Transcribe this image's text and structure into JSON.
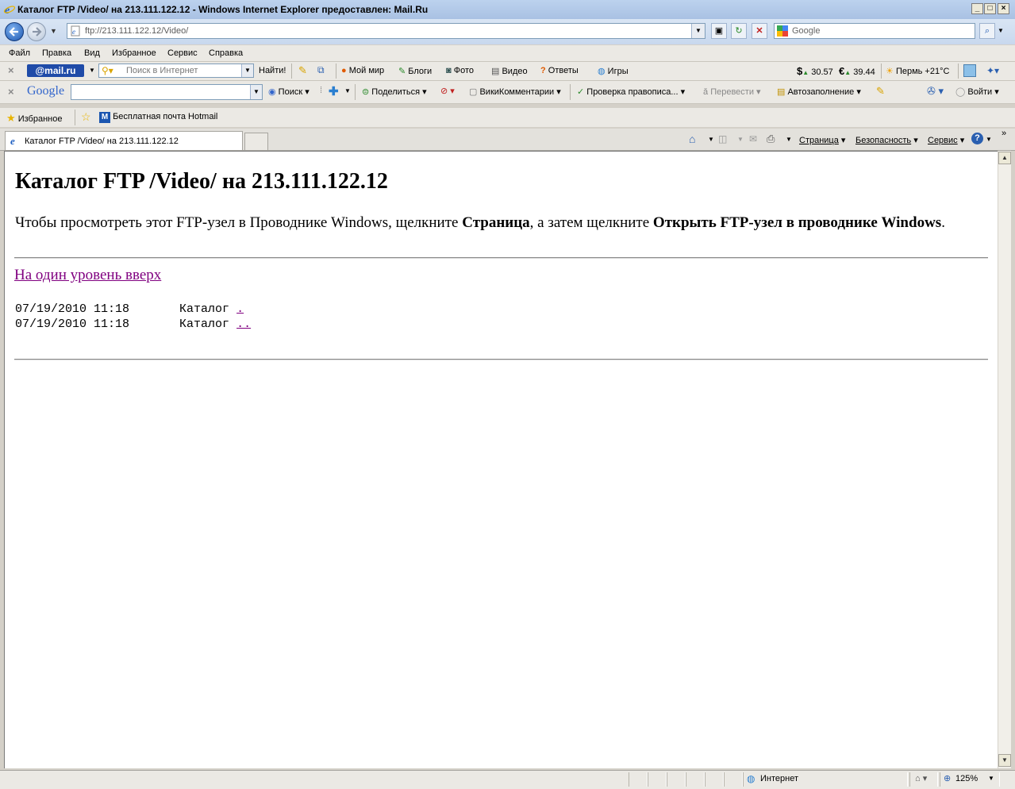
{
  "window": {
    "title": "Каталог FTP /Video/ на 213.111.122.12 - Windows Internet Explorer предоставлен: Mail.Ru",
    "controls": [
      "_",
      "□",
      "×"
    ]
  },
  "address_bar": {
    "url": "ftp://213.111.122.12/Video/",
    "search_placeholder": "Google"
  },
  "menu": [
    "Файл",
    "Правка",
    "Вид",
    "Избранное",
    "Сервис",
    "Справка"
  ],
  "mail_toolbar": {
    "logo": "@mail.ru",
    "search_placeholder": "Поиск в Интернет",
    "find_button": "Найти!",
    "links": [
      "Мой мир",
      "Блоги",
      "Фото",
      "Видео",
      "Ответы",
      "Игры"
    ],
    "usd": "30.57",
    "eur": "39.44",
    "weather": "Пермь +21°C"
  },
  "google_toolbar": {
    "logo": "Google",
    "search_button": "Поиск",
    "share": "Поделиться",
    "wiki": "ВикиКомментарии",
    "spellcheck": "Проверка правописа...",
    "translate": "Перевести",
    "autofill": "Автозаполнение",
    "signin": "Войти"
  },
  "favorites_bar": {
    "favorites": "Избранное",
    "hotmail": "Бесплатная почта Hotmail"
  },
  "tabs": {
    "active": "Каталог FTP /Video/ на 213.111.122.12",
    "command_bar": [
      "Страница",
      "Безопасность",
      "Сервис"
    ]
  },
  "page": {
    "heading": "Каталог FTP /Video/ на 213.111.122.12",
    "intro_1": "Чтобы просмотреть этот FTP-узел в Проводнике Windows, щелкните ",
    "intro_b1": "Страница",
    "intro_2": ", а затем щелкните ",
    "intro_b2": "Открыть FTP-узел в проводнике Windows",
    "intro_3": ".",
    "up_link": "На один уровень вверх",
    "entries": [
      {
        "date": "07/19/2010 11:18",
        "type": "Каталог",
        "name": "."
      },
      {
        "date": "07/19/2010 11:18",
        "type": "Каталог",
        "name": ".."
      }
    ]
  },
  "status_bar": {
    "zone": "Интернет",
    "zoom": "125%"
  }
}
